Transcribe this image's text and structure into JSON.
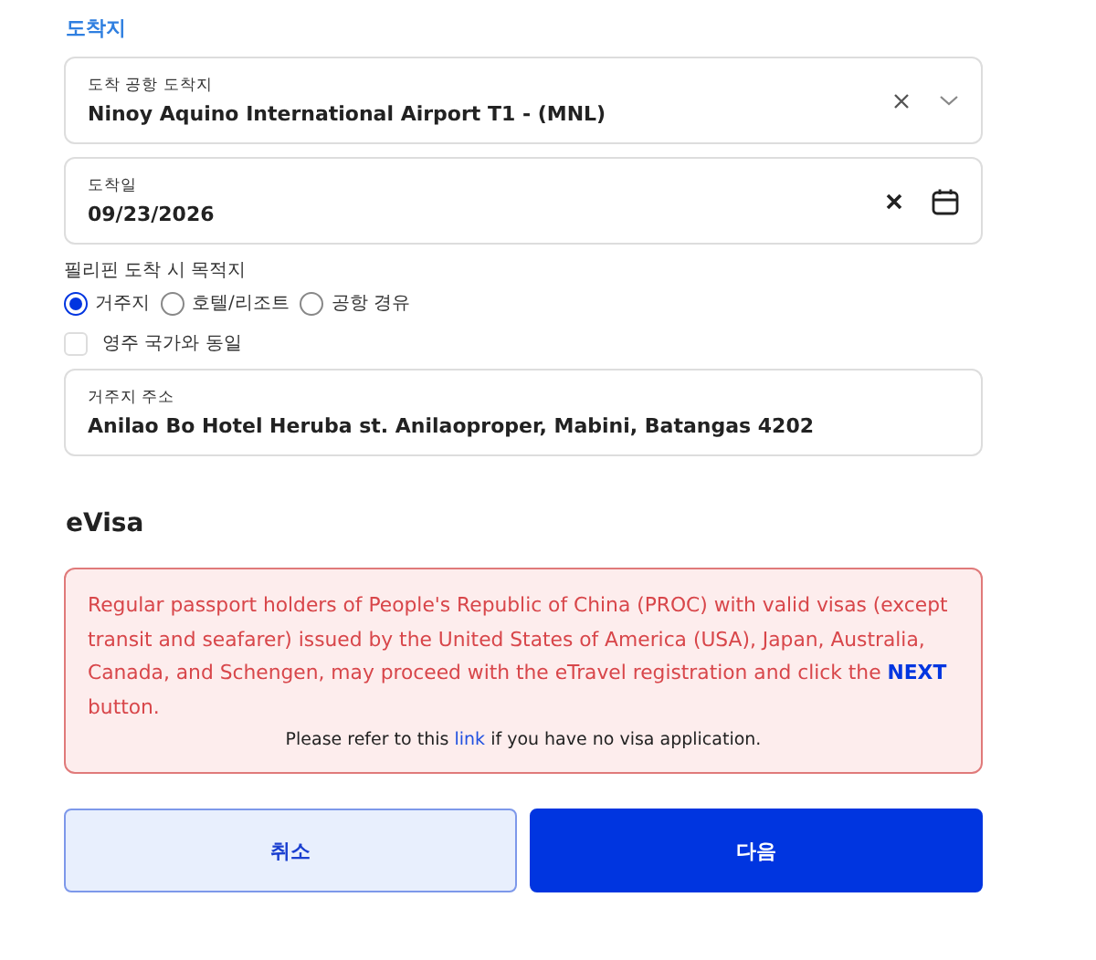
{
  "section_title": "도착지",
  "airport_field": {
    "label": "도착 공항 도착지",
    "value": "Ninoy Aquino International Airport T1 - (MNL)"
  },
  "date_field": {
    "label": "도착일",
    "value": "09/23/2026"
  },
  "destination": {
    "label": "필리핀 도착 시 목적지",
    "options": [
      {
        "label": "거주지",
        "selected": true
      },
      {
        "label": "호텔/리조트",
        "selected": false
      },
      {
        "label": "공항 경유",
        "selected": false
      }
    ]
  },
  "same_as_residence": {
    "label": "영주 국가와 동일",
    "checked": false
  },
  "address_field": {
    "label": "거주지 주소",
    "value": "Anilao Bo Hotel Heruba st. Anilaoproper, Mabini, Batangas 4202"
  },
  "evisa": {
    "title": "eVisa",
    "warning": "Regular passport holders of People's Republic of China (PROC) with valid visas (except transit and seafarer) issued by the United States of America (USA), Japan, Australia, Canada, and Schengen, may proceed with the eTravel registration and click the **NEXT** button.",
    "note_before": "Please refer to this",
    "note_link": "link",
    "note_after": "if you have no visa application."
  },
  "buttons": [
    {
      "label": "취소",
      "kind": "secondary"
    },
    {
      "label": "다음",
      "kind": "primary"
    }
  ]
}
